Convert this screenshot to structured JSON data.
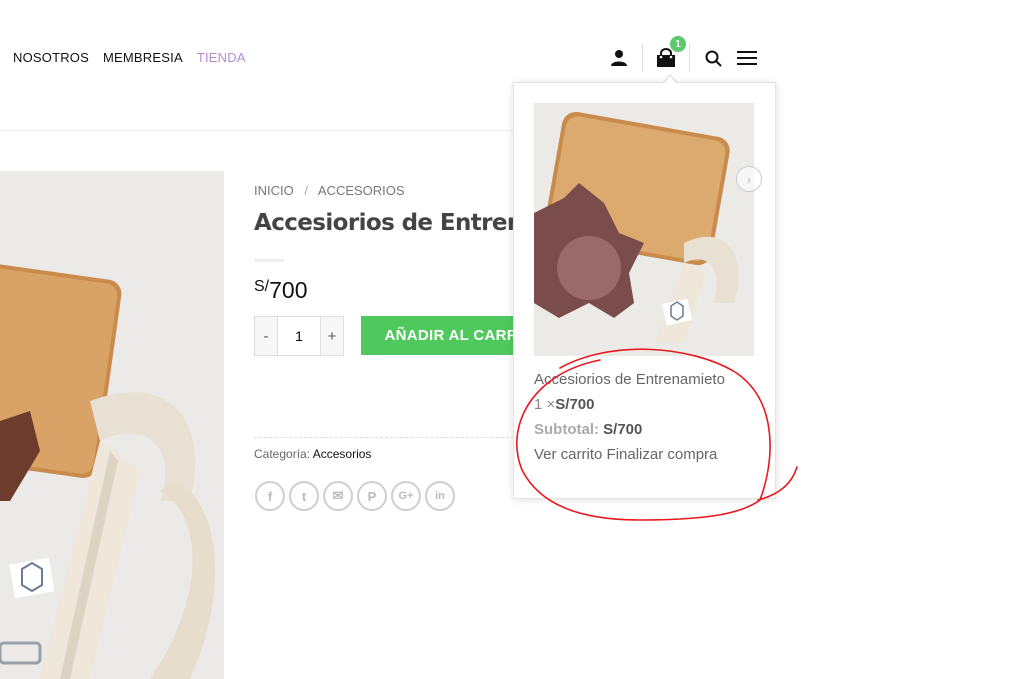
{
  "nav": {
    "items": [
      {
        "label": "NOSOTROS"
      },
      {
        "label": "MEMBRESIA"
      },
      {
        "label": "TIENDA",
        "active": true
      }
    ]
  },
  "header": {
    "icons": [
      "user-icon",
      "shopping-bag-icon",
      "search-icon",
      "menu-icon"
    ],
    "cart_count": "1"
  },
  "breadcrumb": {
    "home": "INICIO",
    "separator": "/",
    "current": "ACCESORIOS"
  },
  "product": {
    "title": "Accesiorios de Entrenamieto",
    "price_currency": "S/",
    "price_amount": "700",
    "quantity": "1",
    "minus_label": "-",
    "plus_label": "+",
    "add_to_cart_label": "AÑADIR AL CARRITO",
    "category_label": "Categoría:",
    "category_value": "Accesorios"
  },
  "share": {
    "icons": [
      {
        "name": "facebook-icon",
        "glyph": "f"
      },
      {
        "name": "twitter-icon",
        "glyph": "t"
      },
      {
        "name": "email-icon",
        "glyph": "✉"
      },
      {
        "name": "pinterest-icon",
        "glyph": "P"
      },
      {
        "name": "google-plus-icon",
        "glyph": "G+"
      },
      {
        "name": "linkedin-icon",
        "glyph": "in"
      }
    ]
  },
  "minicart": {
    "item_name": "Accesiorios de Entrenamieto",
    "item_qty": "1 ×",
    "item_price": "S/700",
    "subtotal_label": "Subtotal:",
    "subtotal_value": "S/700",
    "view_cart_label": "Ver carrito",
    "checkout_label": "Finalizar compra"
  },
  "colors": {
    "accent_green": "#4fc95d",
    "nav_active": "#b58bd8",
    "badge": "#5cc96e",
    "annotation_red": "#e8191f"
  }
}
